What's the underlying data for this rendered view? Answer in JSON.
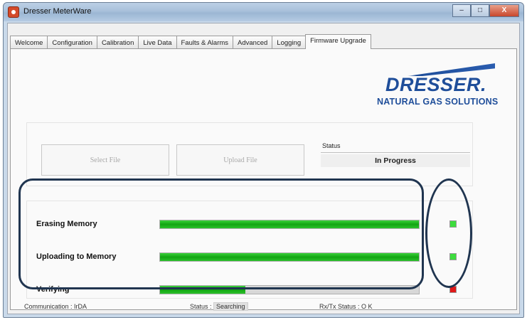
{
  "window": {
    "title": "Dresser MeterWare",
    "min_label": "–",
    "max_label": "□",
    "close_label": "X"
  },
  "tabs": [
    {
      "label": "Welcome"
    },
    {
      "label": "Configuration"
    },
    {
      "label": "Calibration"
    },
    {
      "label": "Live Data"
    },
    {
      "label": "Faults & Alarms"
    },
    {
      "label": "Advanced"
    },
    {
      "label": "Logging"
    },
    {
      "label": "Firmware Upgrade"
    }
  ],
  "active_tab": "Firmware Upgrade",
  "logo": {
    "word": "DRESSER.",
    "tagline": "NATURAL GAS SOLUTIONS",
    "color": "#1f4e9a"
  },
  "file": {
    "select_label": "Select File",
    "upload_label": "Upload File",
    "status_label": "Status",
    "status_value": "In Progress"
  },
  "progress": [
    {
      "label": "Erasing Memory",
      "fraction": 1.0,
      "indicator": "green"
    },
    {
      "label": "Uploading to Memory",
      "fraction": 1.0,
      "indicator": "green"
    },
    {
      "label": "Verifying",
      "fraction": 0.33,
      "indicator": "red"
    }
  ],
  "statusbar": {
    "communication": "Communication : IrDA",
    "status_prefix": "Status :",
    "status_value": "Searching",
    "rxtx": "Rx/Tx Status : O K"
  },
  "colors": {
    "progress_fill": "#12a512",
    "led_ok": "#3ddc3d",
    "led_err": "#e01818",
    "highlight": "#203550"
  }
}
